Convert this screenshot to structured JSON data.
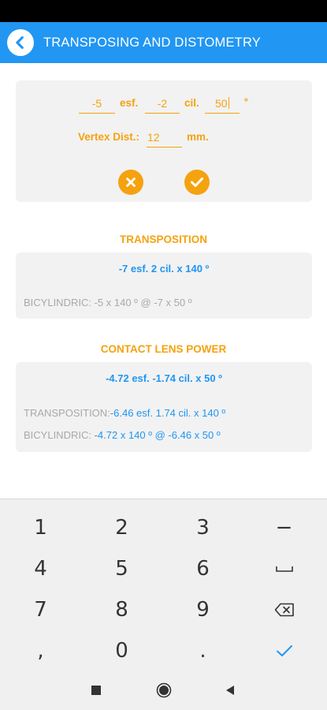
{
  "header": {
    "title": "TRANSPOSING AND DISTOMETRY",
    "back_icon": "back-arrow-icon",
    "color": "#2196f3"
  },
  "form": {
    "sphere_value": "-5",
    "sphere_label": "esf.",
    "cylinder_value": "-2",
    "cylinder_label": "cil.",
    "axis_value": "50",
    "degree_symbol": "º",
    "vertex_label": "Vertex Dist.:",
    "vertex_value": "12",
    "vertex_unit": "mm.",
    "clear_icon": "close-icon",
    "confirm_icon": "check-icon",
    "accent_color": "#f5a20f"
  },
  "transposition": {
    "title": "TRANSPOSITION",
    "result": "-7 esf. 2 cil. x 140 º",
    "bicylindric_label": "BICYLINDRIC:",
    "bicylindric_value": "-5 x 140 º @ -7 x 50 º"
  },
  "contact_lens": {
    "title": "CONTACT LENS POWER",
    "result": "-4.72 esf. -1.74 cil. x 50 º",
    "transposition_label": "TRANSPOSITION:",
    "transposition_value": "-6.46 esf. 1.74 cil. x 140 º",
    "bicylindric_label": "BICYLINDRIC:",
    "bicylindric_value": "-4.72 x 140 º @ -6.46 x 50 º"
  },
  "keyboard": {
    "keys": [
      "1",
      "2",
      "3",
      "−",
      "4",
      "5",
      "6",
      "space-icon",
      "7",
      "8",
      "9",
      "backspace-icon",
      ",",
      "0",
      ".",
      "enter-check-icon"
    ]
  },
  "navigation": {
    "items": [
      "recents-square-icon",
      "home-circle-icon",
      "back-triangle-icon"
    ]
  }
}
